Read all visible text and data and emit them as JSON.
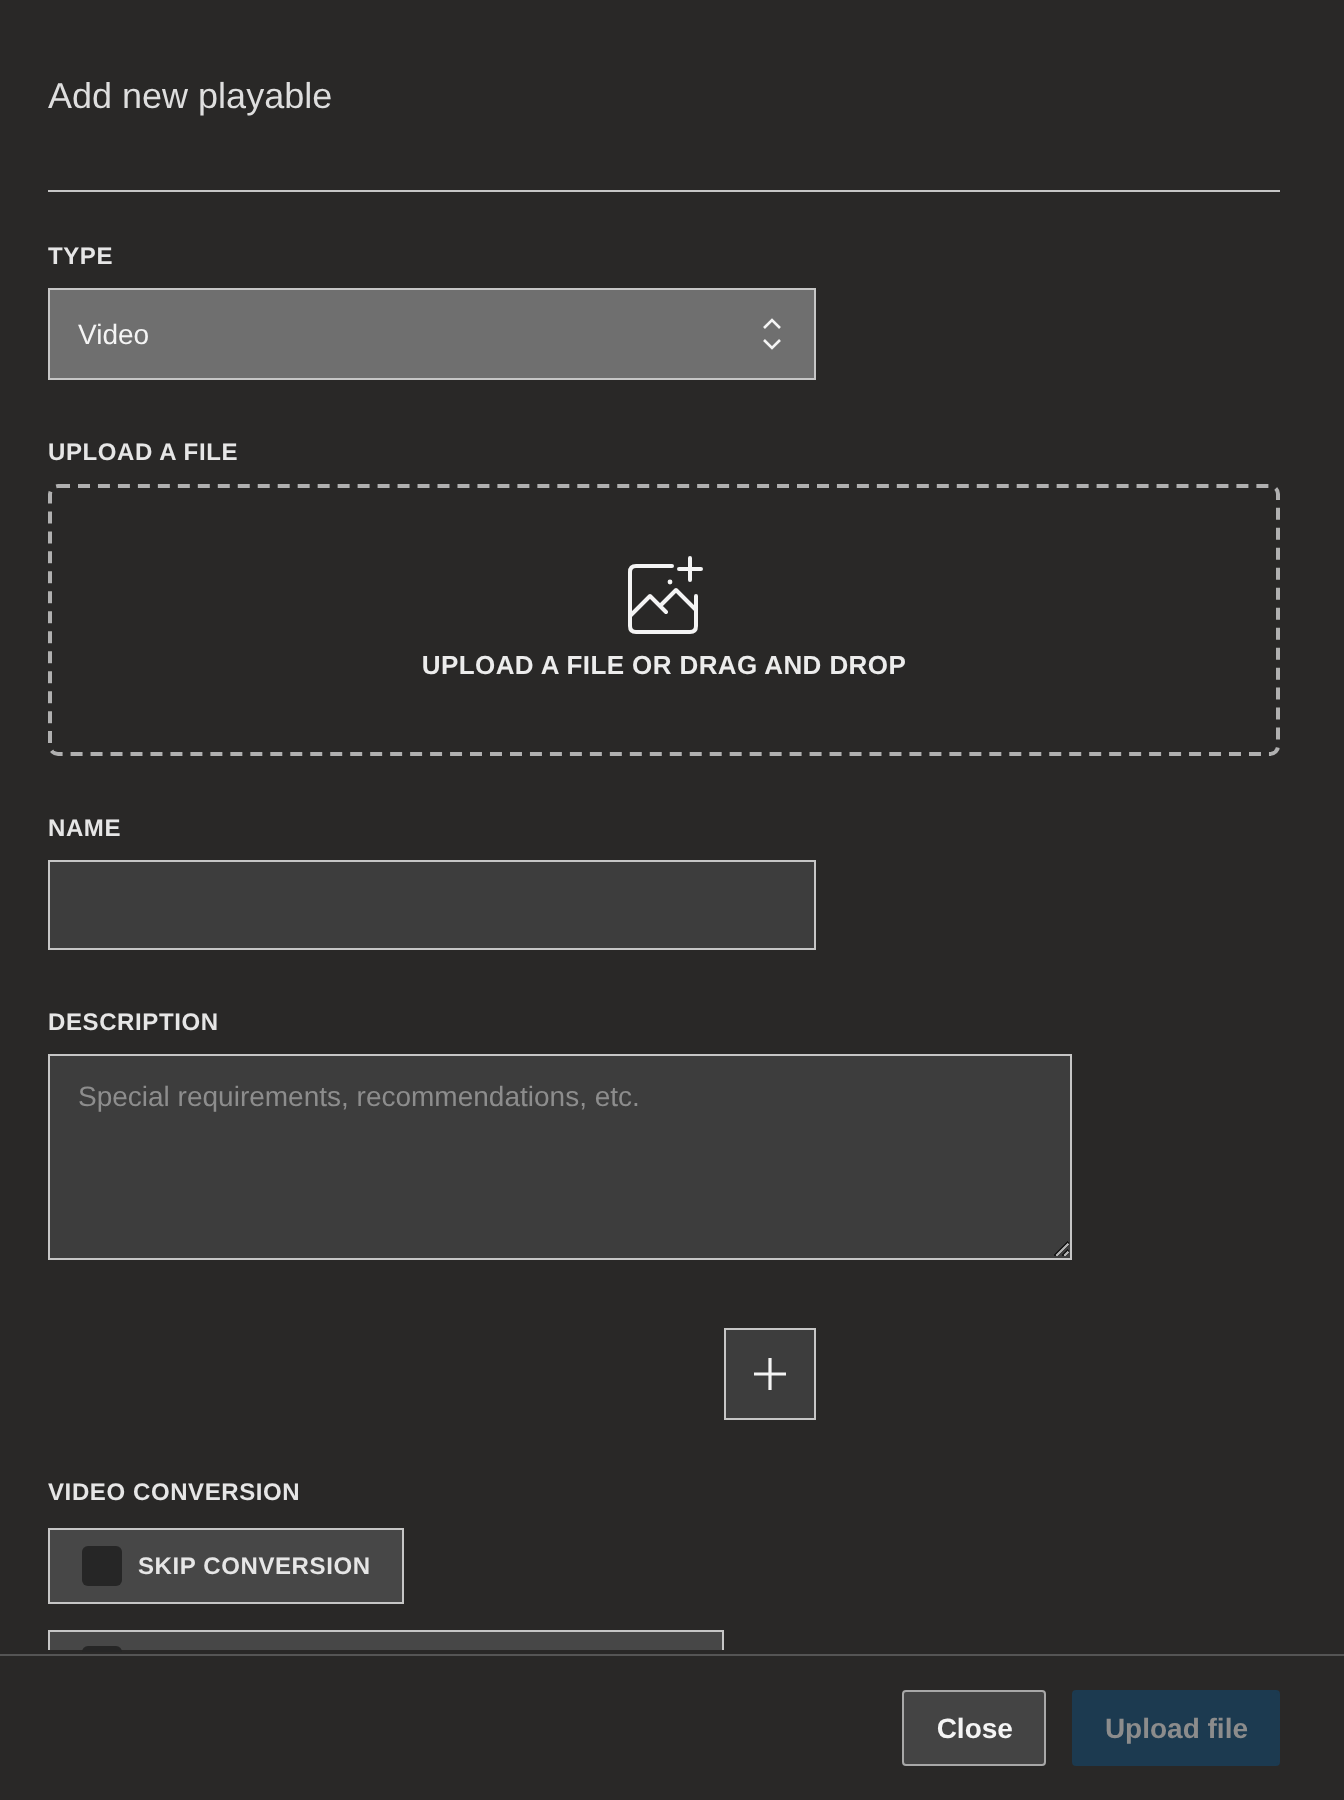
{
  "dialog": {
    "title": "Add new playable"
  },
  "type_field": {
    "label": "TYPE",
    "value": "Video"
  },
  "upload": {
    "label": "UPLOAD A FILE",
    "prompt": "UPLOAD A FILE OR DRAG AND DROP"
  },
  "name_field": {
    "label": "NAME"
  },
  "description_field": {
    "label": "DESCRIPTION",
    "placeholder": "Special requirements, recommendations, etc."
  },
  "video_conversion": {
    "label": "VIDEO CONVERSION",
    "options": [
      {
        "label": "SKIP CONVERSION",
        "checked": false
      },
      {
        "checked": false
      }
    ]
  },
  "footer": {
    "buttons": [
      {
        "label": "Close",
        "kind": "secondary",
        "disabled": false
      },
      {
        "label": "Upload file",
        "kind": "primary",
        "disabled": true
      }
    ]
  }
}
